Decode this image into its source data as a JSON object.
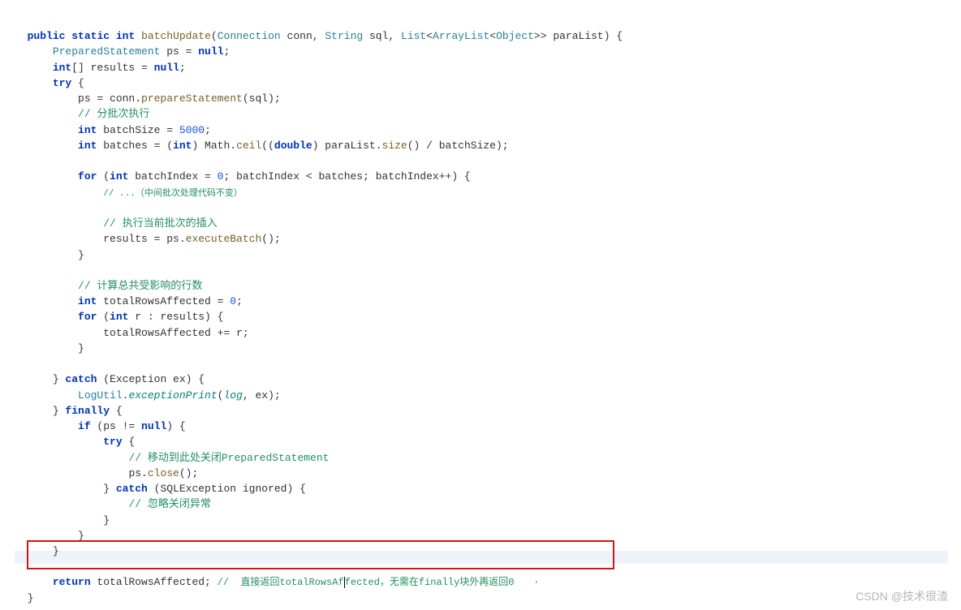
{
  "code": {
    "l1_pre": "  ",
    "l1_kw1": "public",
    "l1_sp1": " ",
    "l1_kw2": "static",
    "l1_sp2": " ",
    "l1_kw3": "int",
    "l1_sp3": " ",
    "l1_me": "batchUpdate",
    "l1_op1": "(",
    "l1_ty1": "Connection",
    "l1_sp4": " ",
    "l1_id1": "conn",
    "l1_sep1": ", ",
    "l1_ty2": "String",
    "l1_sp5": " ",
    "l1_id2": "sql",
    "l1_sep2": ", ",
    "l1_ty3": "List",
    "l1_lt1": "<",
    "l1_ty4": "ArrayList",
    "l1_lt2": "<",
    "l1_ty5": "Object",
    "l1_gt1": ">>",
    "l1_sp6": " ",
    "l1_id3": "paraList",
    "l1_op2": ") {",
    "l2_pre": "      ",
    "l2_ty": "PreparedStatement",
    "l2_rest": " ps = ",
    "l2_kw": "null",
    "l2_end": ";",
    "l3_pre": "      ",
    "l3_kw": "int",
    "l3_rest": "[] results = ",
    "l3_kw2": "null",
    "l3_end": ";",
    "l4_pre": "      ",
    "l4_kw": "try",
    "l4_end": " {",
    "l5_pre": "          ",
    "l5_id1": "ps = conn.",
    "l5_me": "prepareStatement",
    "l5_rest": "(sql);",
    "l6_pre": "          ",
    "l6_co": "// 分批次执行",
    "l7_pre": "          ",
    "l7_kw": "int",
    "l7_rest": " batchSize = ",
    "l7_nu": "5000",
    "l7_end": ";",
    "l8_pre": "          ",
    "l8_kw": "int",
    "l8_rest": " batches = (",
    "l8_kw2": "int",
    "l8_rest2": ") Math.",
    "l8_me": "ceil",
    "l8_rest3": "((",
    "l8_kw3": "double",
    "l8_rest4": ") paraList.",
    "l8_me2": "size",
    "l8_rest5": "() / batchSize);",
    "l9_blank": " ",
    "l10_pre": "          ",
    "l10_kw": "for",
    "l10_rest": " (",
    "l10_kw2": "int",
    "l10_rest2": " batchIndex = ",
    "l10_nu": "0",
    "l10_rest3": "; batchIndex < batches; batchIndex++) {",
    "l11_pre": "              ",
    "l11_co": "// ...（中间批次处理代码不变）",
    "l12_blank": " ",
    "l13_pre": "              ",
    "l13_co": "// 执行当前批次的插入",
    "l14_pre": "              ",
    "l14_rest": "results = ps.",
    "l14_me": "executeBatch",
    "l14_end": "();",
    "l15_pre": "          ",
    "l15_end": "}",
    "l16_blank": " ",
    "l17_pre": "          ",
    "l17_co": "// 计算总共受影响的行数",
    "l18_pre": "          ",
    "l18_kw": "int",
    "l18_rest": " totalRowsAffected = ",
    "l18_nu": "0",
    "l18_end": ";",
    "l19_pre": "          ",
    "l19_kw": "for",
    "l19_rest": " (",
    "l19_kw2": "int",
    "l19_rest2": " r : results) {",
    "l20_pre": "              ",
    "l20_rest": "totalRowsAffected += r;",
    "l21_pre": "          ",
    "l21_end": "}",
    "l22_blank": " ",
    "l23_pre": "      ",
    "l23_end": "} ",
    "l23_kw": "catch",
    "l23_rest": " (Exception ex) {",
    "l24_pre": "          ",
    "l24_ty": "LogUtil",
    "l24_dot": ".",
    "l24_va": "exceptionPrint",
    "l24_rest": "(",
    "l24_va2": "log",
    "l24_rest2": ", ex);",
    "l25_pre": "      ",
    "l25_end": "} ",
    "l25_kw": "finally",
    "l25_rest": " {",
    "l26_pre": "          ",
    "l26_kw": "if",
    "l26_rest": " (ps != ",
    "l26_kw2": "null",
    "l26_rest2": ") {",
    "l27_pre": "              ",
    "l27_kw": "try",
    "l27_rest": " {",
    "l28_pre": "                  ",
    "l28_co": "// 移动到此处关闭PreparedStatement",
    "l29_pre": "                  ",
    "l29_rest": "ps.",
    "l29_me": "close",
    "l29_end": "();",
    "l30_pre": "              ",
    "l30_end": "} ",
    "l30_kw": "catch",
    "l30_rest": " (SQLException ignored) {",
    "l31_pre": "                  ",
    "l31_co": "// 忽略关闭异常",
    "l32_pre": "              ",
    "l32_end": "}",
    "l33_pre": "          ",
    "l33_end": "}",
    "l34_pre": "      ",
    "l34_end": "}",
    "l35_blank": " ",
    "l36_pre": "      ",
    "l36_kw": "return",
    "l36_rest": " totalRowsAffected; ",
    "l36_co1": "//  直接返回totalRowsAf",
    "l36_co2": "fected，无需在finally块外再返回0",
    "l36_dot": "   ·",
    "l37_pre": "  ",
    "l37_end": "}"
  },
  "watermark": "CSDN @技术很渣"
}
